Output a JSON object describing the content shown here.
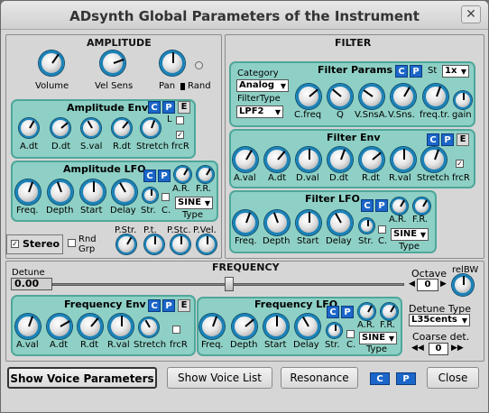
{
  "window": {
    "title": "ADsynth Global Parameters of the Instrument",
    "close": "✕"
  },
  "amplitude": {
    "section_title": "AMPLITUDE",
    "knobs": [
      {
        "label": "Volume"
      },
      {
        "label": "Vel Sens"
      },
      {
        "label": "Pan"
      }
    ],
    "rand_label": "Rand",
    "env": {
      "title": "Amplitude Env",
      "knobs": [
        "A.dt",
        "D.dt",
        "S.val",
        "R.dt",
        "Stretch"
      ],
      "l_label": "L",
      "frcr_label": "frcR",
      "frcr_checked": true
    },
    "lfo": {
      "title": "Amplitude LFO",
      "knobs": [
        "Freq.",
        "Depth",
        "Start",
        "Delay"
      ],
      "str_label": "Str.",
      "c_label": "C.",
      "ar_label": "A.R.",
      "fr_label": "F.R.",
      "type_value": "SINE",
      "type_label": "Type"
    }
  },
  "stereo": {
    "label": "Stereo",
    "checked": true,
    "rnd_label": "Rnd",
    "grp_label": "Grp"
  },
  "punch": {
    "labels": [
      "P.Str.",
      "P.t.",
      "P.Stc.",
      "P.Vel."
    ]
  },
  "filter": {
    "section_title": "FILTER",
    "params": {
      "title": "Filter Params",
      "category_label": "Category",
      "category_value": "Analog",
      "type_label": "FilterType",
      "type_value": "LPF2",
      "st_label": "St",
      "st_value": "1x",
      "knobs": [
        "C.freq",
        "Q",
        "V.SnsA.",
        "V.Sns.",
        "freq.tr.",
        "gain"
      ]
    },
    "env": {
      "title": "Filter Env",
      "knobs": [
        "A.val",
        "A.dt",
        "D.val",
        "D.dt",
        "R.dt",
        "R.val",
        "Stretch"
      ],
      "frcr_label": "frcR",
      "frcr_checked": true
    },
    "lfo": {
      "title": "Filter LFO",
      "knobs": [
        "Freq.",
        "Depth",
        "Start",
        "Delay"
      ],
      "str_label": "Str.",
      "c_label": "C.",
      "ar_label": "A.R.",
      "fr_label": "F.R.",
      "type_value": "SINE",
      "type_label": "Type"
    }
  },
  "frequency": {
    "section_title": "FREQUENCY",
    "detune_label": "Detune",
    "detune_value": "0.00",
    "octave_label": "Octave",
    "octave_value": "0",
    "relbw_label": "relBW",
    "env": {
      "title": "Frequency Env",
      "knobs": [
        "A.val",
        "A.dt",
        "R.dt",
        "R.val",
        "Stretch"
      ],
      "frcr_label": "frcR"
    },
    "lfo": {
      "title": "Frequency LFO",
      "knobs": [
        "Freq.",
        "Depth",
        "Start",
        "Delay"
      ],
      "str_label": "Str.",
      "c_label": "C.",
      "ar_label": "A.R.",
      "fr_label": "F.R.",
      "type_value": "SINE",
      "type_label": "Type"
    },
    "detune_type_label": "Detune Type",
    "detune_type_value": "L35cents",
    "coarse_label": "Coarse det.",
    "coarse_value": "0"
  },
  "common": {
    "c": "C",
    "p": "P",
    "e": "E"
  },
  "bottom": {
    "show_voice_params": "Show Voice Parameters",
    "show_voice_list": "Show Voice List",
    "resonance": "Resonance",
    "close": "Close"
  },
  "colors": {
    "panel": "#8ed0c5",
    "knob_ring": "#1a82b8",
    "cp_button": "#1b66c9"
  }
}
